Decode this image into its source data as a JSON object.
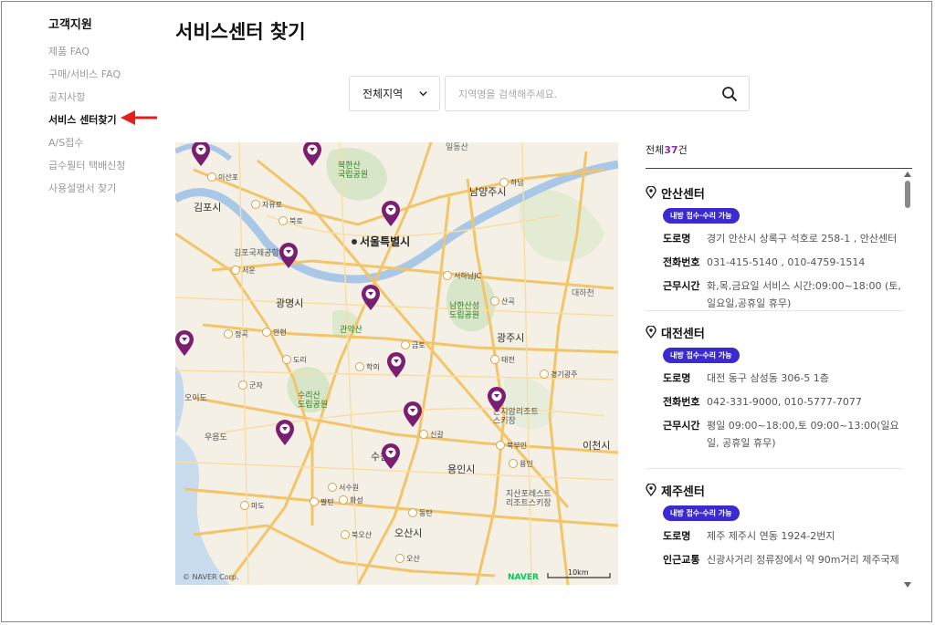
{
  "sidebar": {
    "title": "고객지원",
    "items": [
      {
        "label": "제품 FAQ"
      },
      {
        "label": "구매/서비스 FAQ"
      },
      {
        "label": "공지사항"
      },
      {
        "label": "서비스 센터찾기"
      },
      {
        "label": "A/S접수"
      },
      {
        "label": "급수필터 택배신청"
      },
      {
        "label": "사용설명서 찾기"
      }
    ]
  },
  "page": {
    "title": "서비스센터 찾기"
  },
  "search": {
    "region_selected": "전체지역",
    "placeholder": "지역명을 검색해주세요."
  },
  "map": {
    "copyright": "© NAVER Corp.",
    "logo": "NAVER",
    "scale_label": "10km",
    "labels": {
      "seoul": "서울특별시",
      "gimpo": "김포시",
      "gwangmyeong": "광명시",
      "namyangju": "남양주시",
      "gwangju": "광주시",
      "yongin": "용인시",
      "suwon": "수원시",
      "osan": "오산시",
      "icheon": "이천시",
      "hanam": "하남시",
      "gimpo_airport": "김포국제공항",
      "bukhansan": "북한산\n국립공원",
      "namhansanseong": "남한산성\n도립공원",
      "suri": "수리산\n도립공원",
      "gwanak": "관악산",
      "goni": "곤지암리조트\n스키장",
      "jisan": "지산포레스트\n리조트스키장",
      "oido": "오이도",
      "uiwangdo": "우음도",
      "daehwa": "대하천",
      "ildongsan": "일동산"
    },
    "jc_labels": [
      "이산포",
      "자유로",
      "북로",
      "서운",
      "정곡",
      "안현",
      "도리",
      "군자",
      "학의",
      "금토",
      "서하남JC",
      "산곡",
      "태전",
      "경기광주",
      "하남",
      "북부인",
      "신갈",
      "용인",
      "서수원",
      "동탄",
      "마도",
      "팔탄",
      "화성",
      "북오산",
      "오산"
    ]
  },
  "list": {
    "count_prefix": "전체",
    "count_value": "37",
    "count_suffix": "건",
    "centers": [
      {
        "name": "안산센터",
        "badge": "내방 접수·수리 가능",
        "rows": [
          {
            "k": "도로명",
            "v": "경기 안산시 상록구 석호로 258-1 , 안산센터"
          },
          {
            "k": "전화번호",
            "v": "031-415-5140 , 010-4759-1514"
          },
          {
            "k": "근무시간",
            "v": "화,목,금요일 서비스 시간:09:00~18:00 (토,일요일,공휴일 휴무)"
          }
        ]
      },
      {
        "name": "대전센터",
        "badge": "내방 접수·수리 가능",
        "rows": [
          {
            "k": "도로명",
            "v": "대전 동구 삼성동 306-5 1층"
          },
          {
            "k": "전화번호",
            "v": "042-331-9000, 010-5777-7077"
          },
          {
            "k": "근무시간",
            "v": "평일 09:00~18:00,토 09:00~13:00(일요일, 공휴일 휴무)"
          }
        ]
      },
      {
        "name": "제주센터",
        "badge": "내방 접수·수리 가능",
        "rows": [
          {
            "k": "도로명",
            "v": "제주 제주시 연동 1924-2번지"
          },
          {
            "k": "인근교통",
            "v": "신광사거리 정류장에서 약 90m거리 제주국제"
          }
        ]
      }
    ]
  },
  "colors": {
    "accent_purple": "#8b2da8",
    "badge_blue": "#3a2ad0",
    "marker": "#7a1f6f",
    "arrow_red": "#e0201c"
  }
}
